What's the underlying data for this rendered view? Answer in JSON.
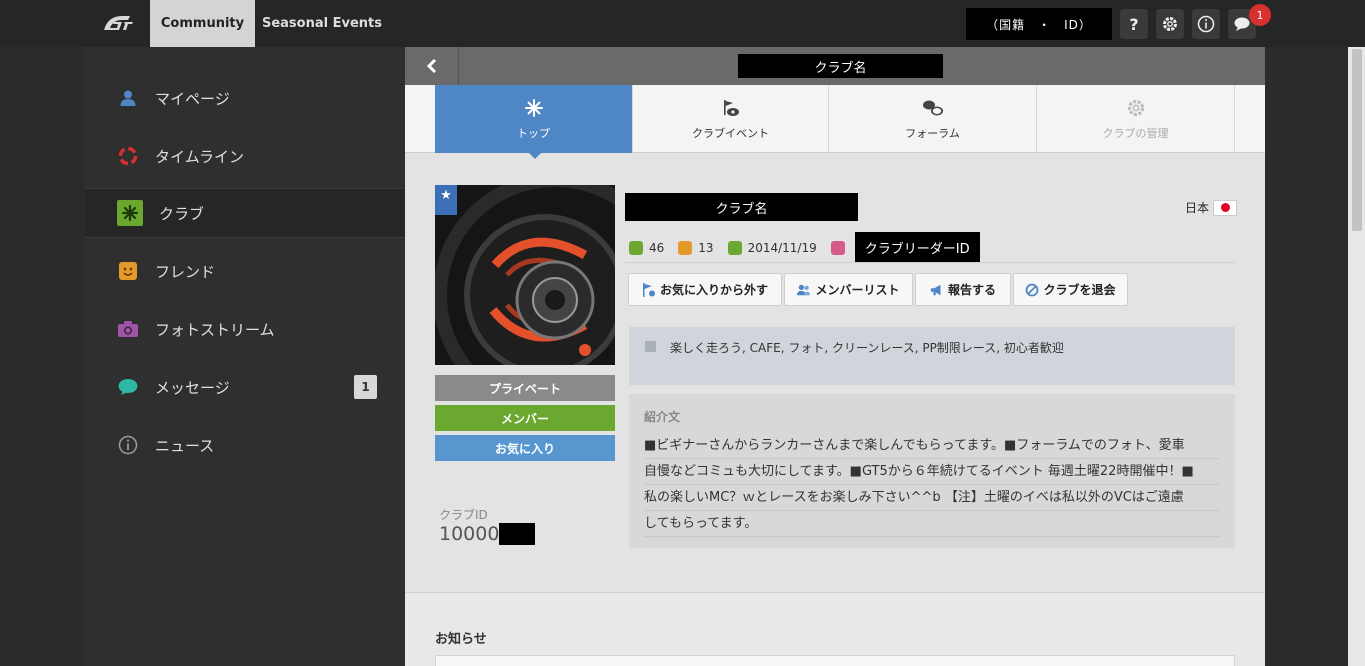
{
  "header": {
    "tabs": [
      "Community",
      "Seasonal Events"
    ],
    "user_label": "（国籍　・　ID）",
    "icons": [
      "help-icon",
      "gear-icon",
      "info-icon",
      "chat-icon"
    ],
    "notification_count": "1",
    "help_glyph": "?",
    "info_glyph": "i"
  },
  "sidebar": {
    "items": [
      {
        "label": "マイページ",
        "icon": "person-icon",
        "color": "#4f86c6"
      },
      {
        "label": "タイムライン",
        "icon": "lifebuoy-icon",
        "color": "#d8302f"
      },
      {
        "label": "クラブ",
        "icon": "snowflake-icon",
        "color": "#6aa82f"
      },
      {
        "label": "フレンド",
        "icon": "smiley-icon",
        "color": "#e39a2b"
      },
      {
        "label": "フォトストリーム",
        "icon": "camera-icon",
        "color": "#a152a9"
      },
      {
        "label": "メッセージ",
        "icon": "speech-bubble-icon",
        "color": "#2db8a5"
      },
      {
        "label": "ニュース",
        "icon": "info-icon",
        "color": "#999999"
      }
    ],
    "message_count": "1"
  },
  "club": {
    "header_name": "クラブ名",
    "tabs": [
      {
        "label": "トップ",
        "icon": "snowflake-icon"
      },
      {
        "label": "クラブイベント",
        "icon": "flag-icon"
      },
      {
        "label": "フォーラム",
        "icon": "chat-bubbles-icon"
      },
      {
        "label": "クラブの管理",
        "icon": "gear-icon"
      }
    ],
    "name": "クラブ名",
    "country": "日本",
    "stats": {
      "posts": "46",
      "members": "13",
      "founded": "2014/11/19"
    },
    "leader": "クラブリーダーID",
    "actions": [
      "お気に入りから外す",
      "メンバーリスト",
      "報告する",
      "クラブを退会"
    ],
    "status_pills": [
      {
        "label": "プライベート",
        "color": "#8a8a8a"
      },
      {
        "label": "メンバー",
        "color": "#6aa82f"
      },
      {
        "label": "お気に入り",
        "color": "#5796cf"
      }
    ],
    "club_id_label": "クラブID",
    "club_id_prefix": "10000",
    "tags": "楽しく走ろう, CAFE, フォト, クリーンレース, PP制限レース, 初心者歓迎",
    "intro_label": "紹介文",
    "intro_lines": [
      "■ビギナーさんからランカーさんまで楽しんでもらってます。■フォーラムでのフォト、愛車",
      "自慢などコミュも大切にしてます。■GT5から６年続けてるイベント 毎週土曜22時開催中！■",
      "私の楽しいMC？ｗとレースをお楽しみ下さい^^b 【注】土曜のイベは私以外のVCはご遠慮",
      "してもらってます。"
    ],
    "notice_title": "お知らせ"
  }
}
